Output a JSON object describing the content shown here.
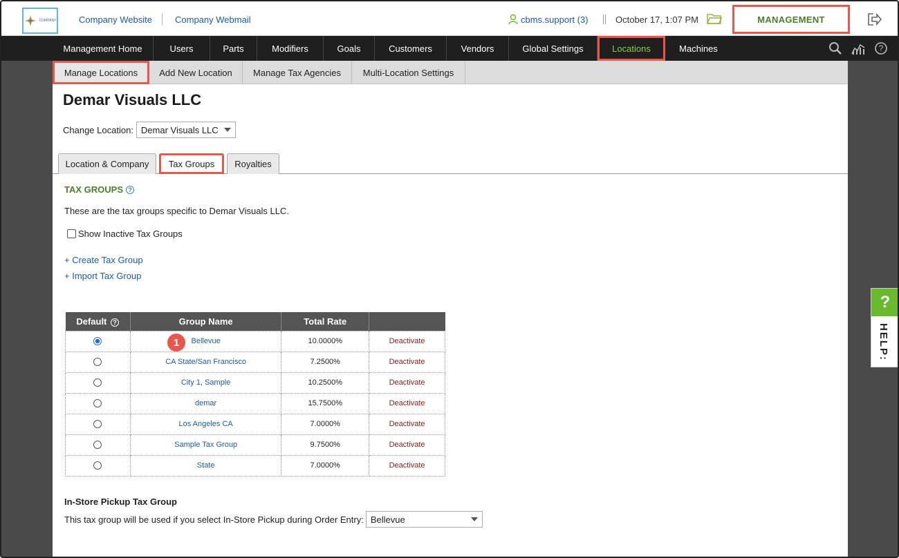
{
  "topbar": {
    "logo_text": "COMPANY",
    "company_website": "Company Website",
    "company_webmail": "Company Webmail",
    "user": "cbms.support (3)",
    "datetime": "October 17, 1:07 PM",
    "management": "MANAGEMENT"
  },
  "mainnav": {
    "items": [
      "Management Home",
      "Users",
      "Parts",
      "Modifiers",
      "Goals",
      "Customers",
      "Vendors",
      "Global Settings",
      "Locations",
      "Machines"
    ],
    "active": "Locations"
  },
  "subnav": {
    "items": [
      "Manage Locations",
      "Add New Location",
      "Manage Tax Agencies",
      "Multi-Location Settings"
    ],
    "active": "Manage Locations"
  },
  "page": {
    "title": "Demar Visuals LLC",
    "change_location_label": "Change Location:",
    "change_location_value": "Demar Visuals LLC",
    "tabs": [
      "Location & Company",
      "Tax Groups",
      "Royalties"
    ],
    "active_tab": "Tax Groups",
    "section_title": "TAX GROUPS",
    "description": "These are the tax groups specific to Demar Visuals LLC.",
    "show_inactive": "Show Inactive Tax Groups",
    "create_link": "+ Create Tax Group",
    "import_link": "+ Import Tax Group"
  },
  "table": {
    "headers": [
      "Default",
      "Group Name",
      "Total Rate",
      ""
    ],
    "rows": [
      {
        "name": "Bellevue",
        "rate": "10.0000%",
        "action": "Deactivate",
        "default": true
      },
      {
        "name": "CA State/San Francisco",
        "rate": "7.2500%",
        "action": "Deactivate",
        "default": false
      },
      {
        "name": "City 1, Sample",
        "rate": "10.2500%",
        "action": "Deactivate",
        "default": false
      },
      {
        "name": "demar",
        "rate": "15.7500%",
        "action": "Deactivate",
        "default": false
      },
      {
        "name": "Los Angeles CA",
        "rate": "7.0000%",
        "action": "Deactivate",
        "default": false
      },
      {
        "name": "Sample Tax Group",
        "rate": "9.7500%",
        "action": "Deactivate",
        "default": false
      },
      {
        "name": "State",
        "rate": "7.0000%",
        "action": "Deactivate",
        "default": false
      }
    ]
  },
  "annotation": {
    "badge": "1"
  },
  "pickup": {
    "title": "In-Store Pickup Tax Group",
    "label": "This tax group will be used if you select In-Store Pickup during Order Entry:",
    "value": "Bellevue"
  },
  "help": {
    "icon": "?",
    "label": "HELP:"
  },
  "colors": {
    "accent_green": "#4a7d2a",
    "highlight": "#e8574c",
    "nav_bg": "#1f1f1f"
  }
}
